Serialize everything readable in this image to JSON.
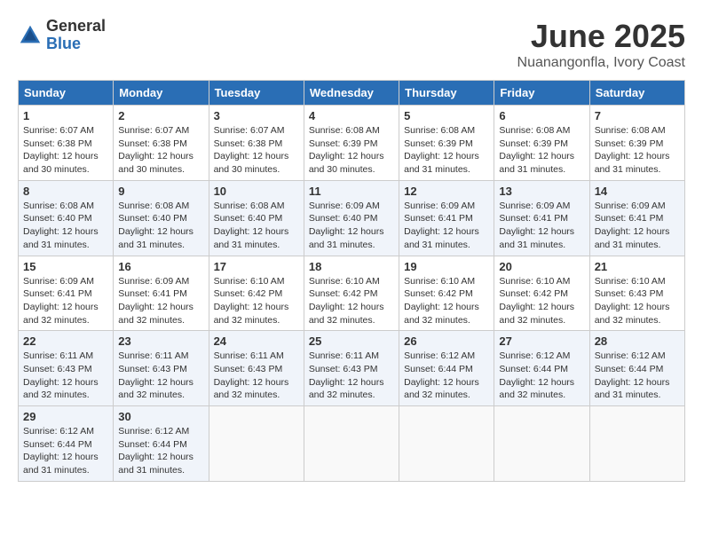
{
  "header": {
    "logo_general": "General",
    "logo_blue": "Blue",
    "month_title": "June 2025",
    "subtitle": "Nuanangonfla, Ivory Coast"
  },
  "columns": [
    "Sunday",
    "Monday",
    "Tuesday",
    "Wednesday",
    "Thursday",
    "Friday",
    "Saturday"
  ],
  "weeks": [
    [
      {
        "day": "1",
        "sunrise": "6:07 AM",
        "sunset": "6:38 PM",
        "daylight": "12 hours and 30 minutes."
      },
      {
        "day": "2",
        "sunrise": "6:07 AM",
        "sunset": "6:38 PM",
        "daylight": "12 hours and 30 minutes."
      },
      {
        "day": "3",
        "sunrise": "6:07 AM",
        "sunset": "6:38 PM",
        "daylight": "12 hours and 30 minutes."
      },
      {
        "day": "4",
        "sunrise": "6:08 AM",
        "sunset": "6:39 PM",
        "daylight": "12 hours and 30 minutes."
      },
      {
        "day": "5",
        "sunrise": "6:08 AM",
        "sunset": "6:39 PM",
        "daylight": "12 hours and 31 minutes."
      },
      {
        "day": "6",
        "sunrise": "6:08 AM",
        "sunset": "6:39 PM",
        "daylight": "12 hours and 31 minutes."
      },
      {
        "day": "7",
        "sunrise": "6:08 AM",
        "sunset": "6:39 PM",
        "daylight": "12 hours and 31 minutes."
      }
    ],
    [
      {
        "day": "8",
        "sunrise": "6:08 AM",
        "sunset": "6:40 PM",
        "daylight": "12 hours and 31 minutes."
      },
      {
        "day": "9",
        "sunrise": "6:08 AM",
        "sunset": "6:40 PM",
        "daylight": "12 hours and 31 minutes."
      },
      {
        "day": "10",
        "sunrise": "6:08 AM",
        "sunset": "6:40 PM",
        "daylight": "12 hours and 31 minutes."
      },
      {
        "day": "11",
        "sunrise": "6:09 AM",
        "sunset": "6:40 PM",
        "daylight": "12 hours and 31 minutes."
      },
      {
        "day": "12",
        "sunrise": "6:09 AM",
        "sunset": "6:41 PM",
        "daylight": "12 hours and 31 minutes."
      },
      {
        "day": "13",
        "sunrise": "6:09 AM",
        "sunset": "6:41 PM",
        "daylight": "12 hours and 31 minutes."
      },
      {
        "day": "14",
        "sunrise": "6:09 AM",
        "sunset": "6:41 PM",
        "daylight": "12 hours and 31 minutes."
      }
    ],
    [
      {
        "day": "15",
        "sunrise": "6:09 AM",
        "sunset": "6:41 PM",
        "daylight": "12 hours and 32 minutes."
      },
      {
        "day": "16",
        "sunrise": "6:09 AM",
        "sunset": "6:41 PM",
        "daylight": "12 hours and 32 minutes."
      },
      {
        "day": "17",
        "sunrise": "6:10 AM",
        "sunset": "6:42 PM",
        "daylight": "12 hours and 32 minutes."
      },
      {
        "day": "18",
        "sunrise": "6:10 AM",
        "sunset": "6:42 PM",
        "daylight": "12 hours and 32 minutes."
      },
      {
        "day": "19",
        "sunrise": "6:10 AM",
        "sunset": "6:42 PM",
        "daylight": "12 hours and 32 minutes."
      },
      {
        "day": "20",
        "sunrise": "6:10 AM",
        "sunset": "6:42 PM",
        "daylight": "12 hours and 32 minutes."
      },
      {
        "day": "21",
        "sunrise": "6:10 AM",
        "sunset": "6:43 PM",
        "daylight": "12 hours and 32 minutes."
      }
    ],
    [
      {
        "day": "22",
        "sunrise": "6:11 AM",
        "sunset": "6:43 PM",
        "daylight": "12 hours and 32 minutes."
      },
      {
        "day": "23",
        "sunrise": "6:11 AM",
        "sunset": "6:43 PM",
        "daylight": "12 hours and 32 minutes."
      },
      {
        "day": "24",
        "sunrise": "6:11 AM",
        "sunset": "6:43 PM",
        "daylight": "12 hours and 32 minutes."
      },
      {
        "day": "25",
        "sunrise": "6:11 AM",
        "sunset": "6:43 PM",
        "daylight": "12 hours and 32 minutes."
      },
      {
        "day": "26",
        "sunrise": "6:12 AM",
        "sunset": "6:44 PM",
        "daylight": "12 hours and 32 minutes."
      },
      {
        "day": "27",
        "sunrise": "6:12 AM",
        "sunset": "6:44 PM",
        "daylight": "12 hours and 32 minutes."
      },
      {
        "day": "28",
        "sunrise": "6:12 AM",
        "sunset": "6:44 PM",
        "daylight": "12 hours and 31 minutes."
      }
    ],
    [
      {
        "day": "29",
        "sunrise": "6:12 AM",
        "sunset": "6:44 PM",
        "daylight": "12 hours and 31 minutes."
      },
      {
        "day": "30",
        "sunrise": "6:12 AM",
        "sunset": "6:44 PM",
        "daylight": "12 hours and 31 minutes."
      },
      null,
      null,
      null,
      null,
      null
    ]
  ]
}
